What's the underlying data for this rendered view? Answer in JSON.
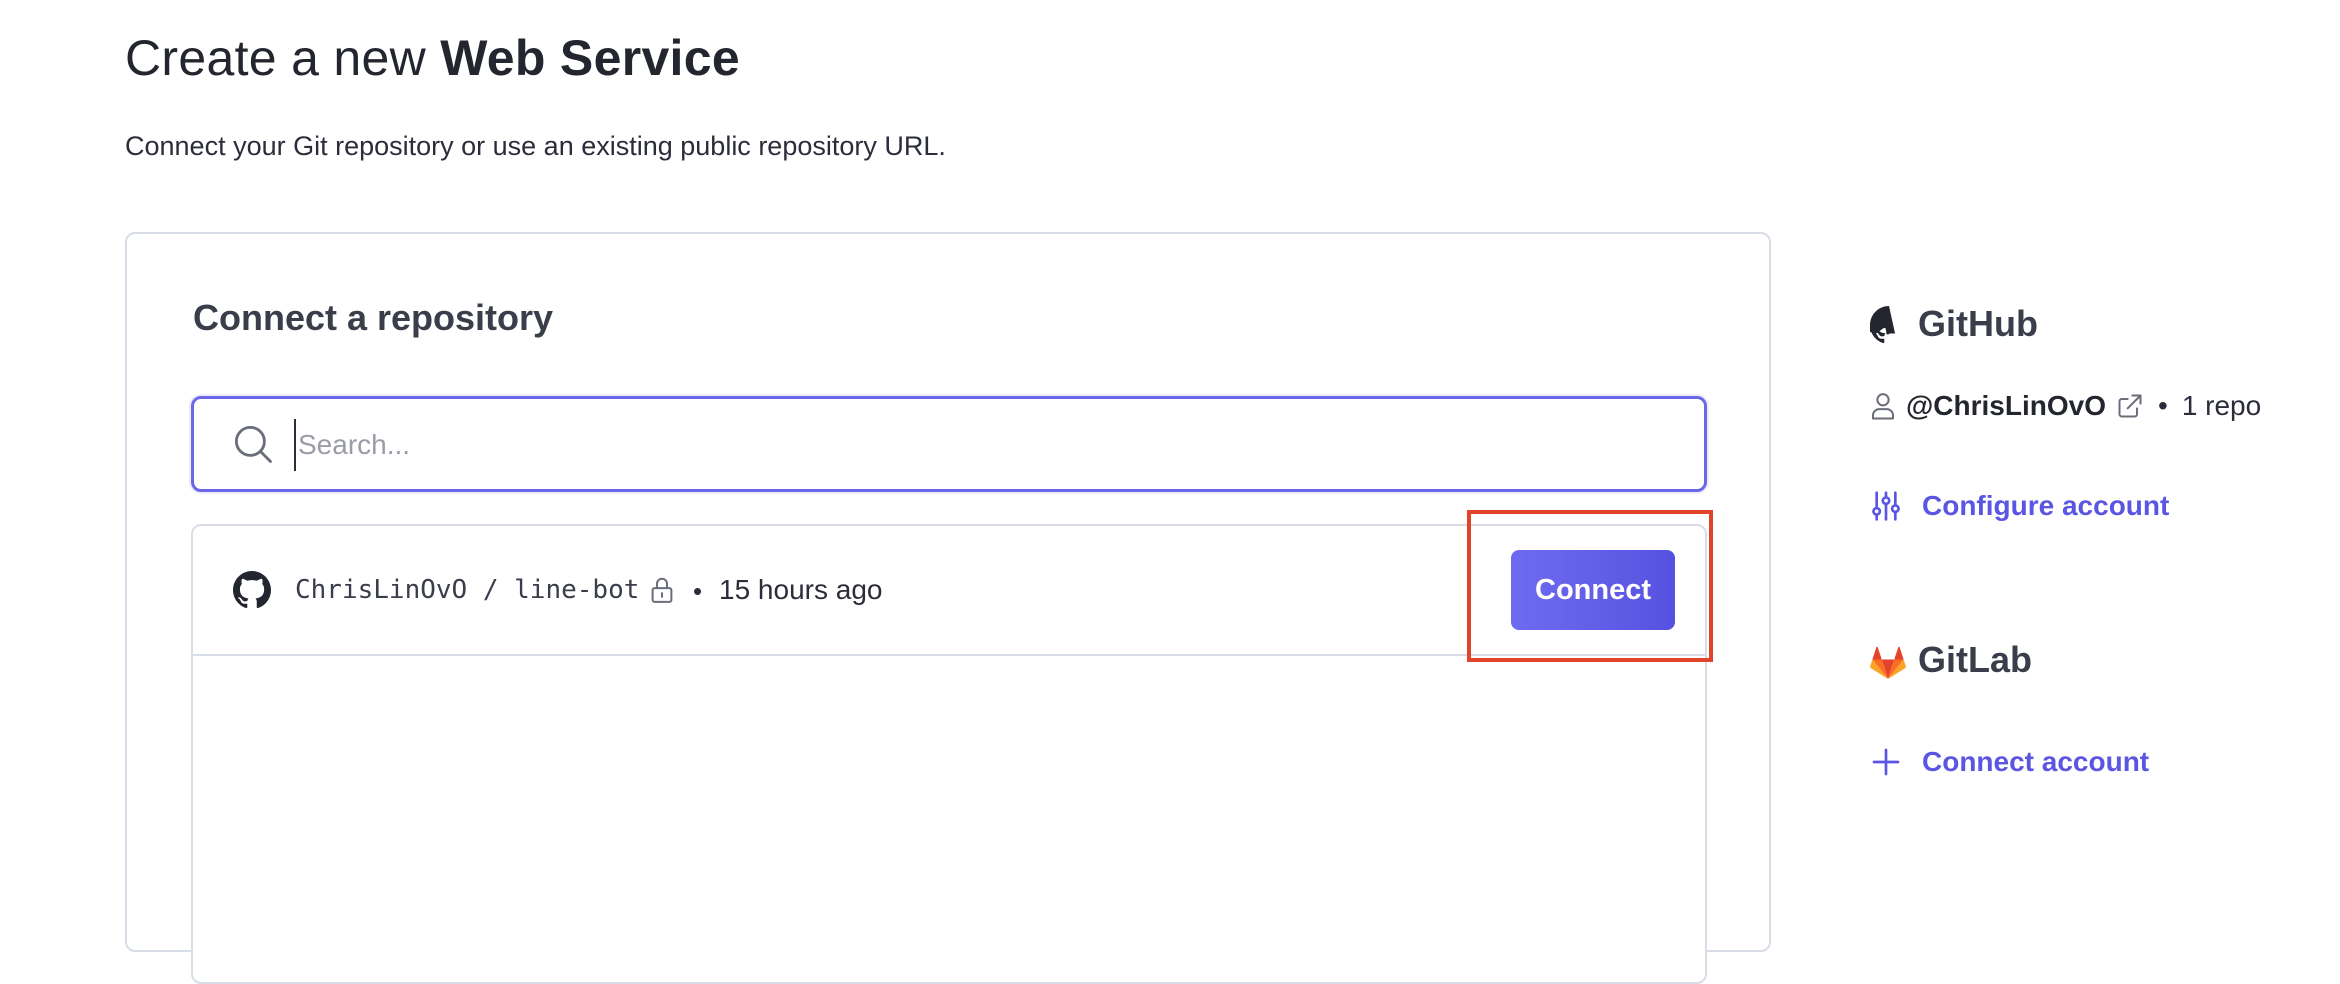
{
  "header": {
    "title_prefix": "Create a new",
    "title_emphasis": "Web Service",
    "subtitle": "Connect your Git repository or use an existing public repository URL."
  },
  "connect_panel": {
    "title": "Connect a repository",
    "search": {
      "placeholder": "Search...",
      "value": ""
    },
    "repos": [
      {
        "owner": "ChrisLinOvO",
        "separator": "/",
        "name": "line-bot",
        "visibility_icon": "lock-icon",
        "dot": "•",
        "updated": "15 hours ago",
        "connect_label": "Connect"
      }
    ]
  },
  "providers": {
    "github": {
      "title": "GitHub",
      "icon": "github-icon",
      "account": "@ChrisLinOvO",
      "dot": "•",
      "repo_count": "1 repo",
      "configure_label": "Configure account"
    },
    "gitlab": {
      "title": "GitLab",
      "icon": "gitlab-icon",
      "connect_label": "Connect account"
    }
  },
  "colors": {
    "accent": "#5a55e3",
    "button_gradient_start": "#6f6bf0",
    "button_gradient_end": "#5652e0",
    "highlight": "#e0452a",
    "border": "#d9dde8",
    "gitlab_orange": "#e2432a"
  }
}
